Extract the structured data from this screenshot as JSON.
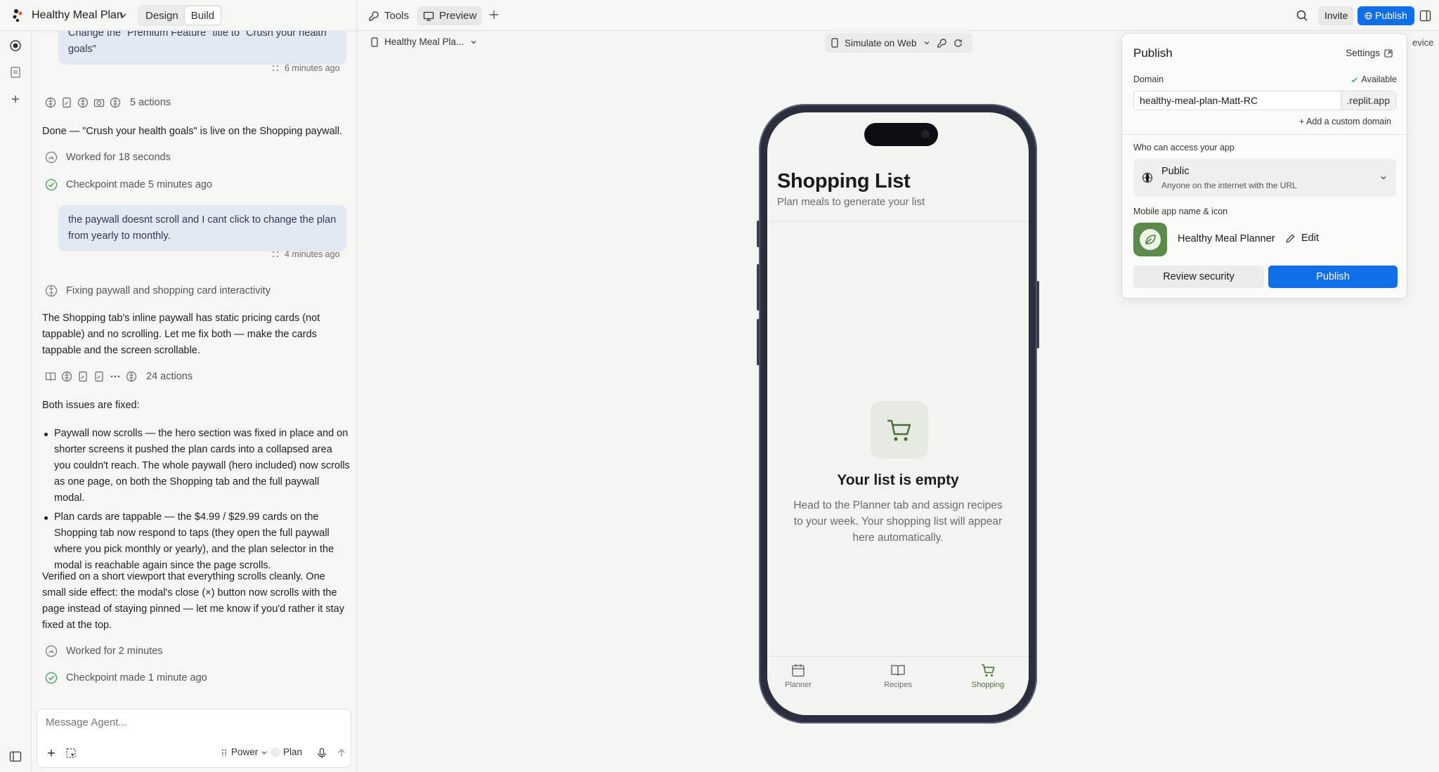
{
  "topbar": {
    "project_title": "Healthy Meal Plan",
    "mode_tabs": [
      "Design",
      "Build"
    ],
    "tools_label": "Tools",
    "preview_label": "Preview",
    "invite_label": "Invite",
    "publish_label": "Publish"
  },
  "chat": {
    "user_msg_1": "Change the \"Premium Feature\" title to \"Crush your health goals\"",
    "user_msg_1_time": "6 minutes ago",
    "actions_1": "5 actions",
    "done_text": "Done — \"Crush your health goals\" is live on the Shopping paywall.",
    "worked_1": "Worked for 18 seconds",
    "checkpoint_1": "Checkpoint made 5 minutes ago",
    "user_msg_2": "the paywall doesnt scroll and I cant click to change the plan from yearly to monthly.",
    "user_msg_2_time": "4 minutes ago",
    "task_label": "Fixing paywall and shopping card interactivity",
    "analysis_text": "The Shopping tab's inline paywall has static pricing cards (not tappable) and no scrolling. Let me fix both — make the cards tappable and the screen scrollable.",
    "actions_2": "24 actions",
    "fixed_heading": "Both issues are fixed:",
    "bullet_1": "Paywall now scrolls — the hero section was fixed in place and on shorter screens it pushed the plan cards into a collapsed area you couldn't reach. The whole paywall (hero included) now scrolls as one page, on both the Shopping tab and the full paywall modal.",
    "bullet_2": "Plan cards are tappable — the $4.99 / $29.99 cards on the Shopping tab now respond to taps (they open the full paywall where you pick monthly or yearly), and the plan selector in the modal is reachable again since the page scrolls.",
    "verified_text": "Verified on a short viewport that everything scrolls cleanly. One small side effect: the modal's close (×) button now scrolls with the page instead of staying pinned — let me know if you'd rather it stay fixed at the top.",
    "worked_2": "Worked for 2 minutes",
    "checkpoint_2": "Checkpoint made 1 minute ago"
  },
  "composer": {
    "placeholder": "Message Agent...",
    "mode_label": "Power",
    "plan_label": "Plan"
  },
  "preview": {
    "app_selector": "Healthy Meal Pla...",
    "simulate_label": "Simulate on Web",
    "behind_text": "evice"
  },
  "phone_app": {
    "title": "Shopping List",
    "subtitle": "Plan meals to generate your list",
    "empty_title": "Your list is empty",
    "empty_body": "Head to the Planner tab and assign recipes to your week. Your shopping list will appear here automatically.",
    "tabs": [
      "Planner",
      "Recipes",
      "Shopping"
    ],
    "active_tab": "Shopping",
    "accent_color": "#4a6e3a"
  },
  "publish_panel": {
    "title": "Publish",
    "settings_label": "Settings",
    "domain_label": "Domain",
    "available_label": "Available",
    "domain_value": "healthy-meal-plan-Matt-RC",
    "domain_suffix": ".replit.app",
    "custom_domain_label": "Add a custom domain",
    "access_label": "Who can access your app",
    "access_title": "Public",
    "access_sub": "Anyone on the internet with the URL",
    "mobile_label": "Mobile app name & icon",
    "app_name": "Healthy Meal Planner",
    "edit_label": "Edit",
    "review_label": "Review security",
    "publish_label": "Publish",
    "publish_color": "#0f6fe8"
  }
}
